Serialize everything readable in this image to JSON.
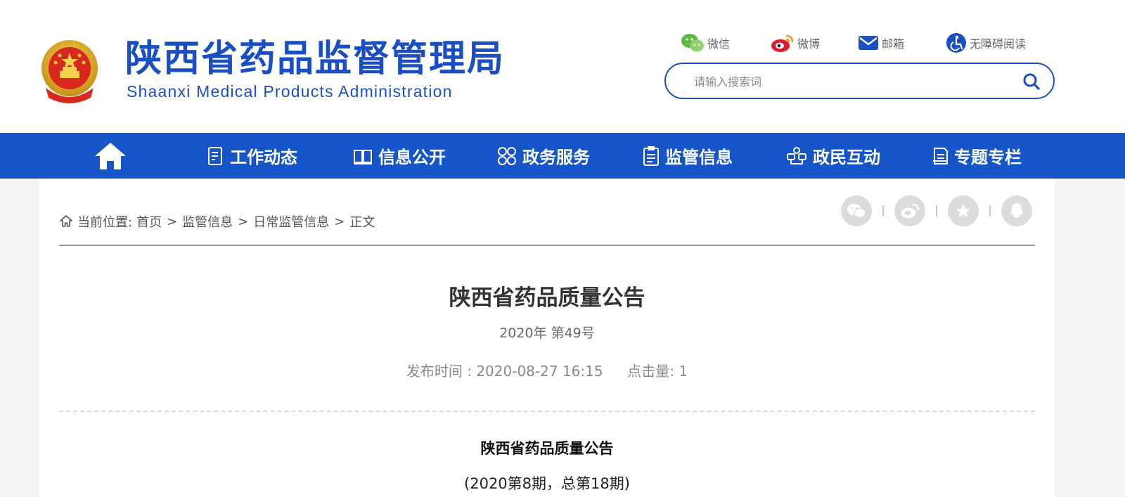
{
  "header": {
    "title_cn": "陕西省药品监督管理局",
    "title_en": "Shaanxi Medical Products Administration",
    "top_links": [
      {
        "label": "微信",
        "icon": "wechat-icon"
      },
      {
        "label": "微博",
        "icon": "weibo-icon"
      },
      {
        "label": "邮箱",
        "icon": "mail-icon"
      },
      {
        "label": "无障碍阅读",
        "icon": "accessibility-icon"
      }
    ],
    "search": {
      "placeholder": "请输入搜索词",
      "value": ""
    }
  },
  "nav": {
    "home_icon": "home-icon",
    "items": [
      {
        "label": "工作动态",
        "icon": "document-list-icon"
      },
      {
        "label": "信息公开",
        "icon": "open-book-icon"
      },
      {
        "label": "政务服务",
        "icon": "grid-icon"
      },
      {
        "label": "监管信息",
        "icon": "clipboard-icon"
      },
      {
        "label": "政民互动",
        "icon": "interaction-icon"
      },
      {
        "label": "专题专栏",
        "icon": "notepad-icon"
      }
    ]
  },
  "breadcrumb": {
    "label": "当前位置:",
    "items": [
      "首页",
      "监管信息",
      "日常监管信息",
      "正文"
    ],
    "separator": ">"
  },
  "share": [
    "wechat-share-icon",
    "weibo-share-icon",
    "favorite-star-icon",
    "qq-share-icon"
  ],
  "article": {
    "title": "陕西省药品质量公告",
    "issue": "2020年 第49号",
    "publish_label": "发布时间 :",
    "publish_time": "2020-08-27 16:15",
    "clicks_label": "点击量:",
    "clicks": "1",
    "body_title": "陕西省药品质量公告",
    "body_subtitle": "(2020第8期，总第18期)"
  },
  "colors": {
    "brand_blue": "#1a4fc4",
    "nav_blue": "#1655c8",
    "page_bg": "#f3f3f3"
  }
}
